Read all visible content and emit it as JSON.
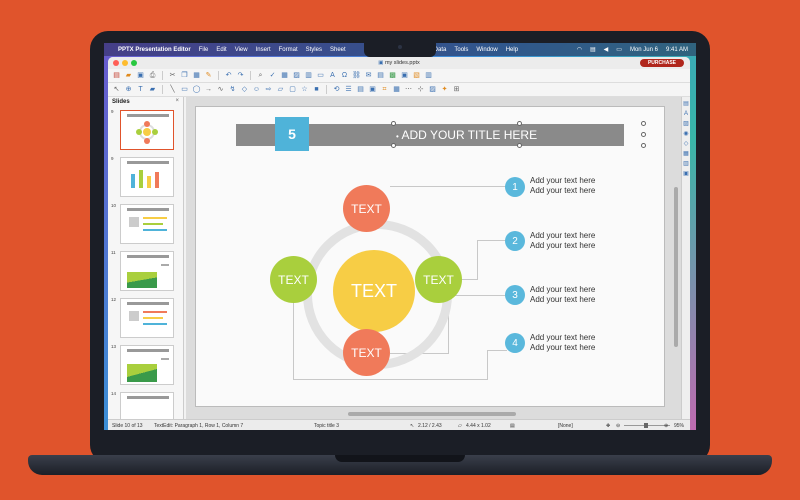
{
  "menubar": {
    "app_name": "PPTX Presentation Editor",
    "items": [
      "File",
      "Edit",
      "View",
      "Insert",
      "Format",
      "Styles",
      "Sheet",
      "Data",
      "Tools",
      "Window",
      "Help"
    ],
    "date": "Mon Jun 6",
    "time": "9:41 AM"
  },
  "window": {
    "title": "my slides.pptx",
    "purchase_label": "PURCHASE"
  },
  "slides_panel": {
    "title": "Slides",
    "close": "×",
    "thumbnails": [
      {
        "number": "9"
      },
      {
        "number": "9"
      },
      {
        "number": "10"
      },
      {
        "number": "11"
      },
      {
        "number": "12"
      },
      {
        "number": "13"
      },
      {
        "number": "14"
      }
    ]
  },
  "slide": {
    "number": "5",
    "title": "ADD YOUR TITLE HERE",
    "center_label": "TEXT",
    "top_label": "TEXT",
    "bottom_label": "TEXT",
    "left_label": "TEXT",
    "right_label": "TEXT",
    "items": [
      {
        "number": "1",
        "line1": "Add your text here",
        "line2": "Add your text here"
      },
      {
        "number": "2",
        "line1": "Add your text here",
        "line2": "Add your text here"
      },
      {
        "number": "3",
        "line1": "Add your text here",
        "line2": "Add your text here"
      },
      {
        "number": "4",
        "line1": "Add your text here",
        "line2": "Add your text here"
      }
    ]
  },
  "statusbar": {
    "slide_info": "Slide 10 of 13",
    "edit_info": "TextEdit: Paragraph 1, Row 1, Column 7",
    "topic": "Topic title 3",
    "position": "2.12 / 2.43",
    "size": "4.44 x 1.02",
    "selection": "[None]",
    "zoom": "95%"
  },
  "colors": {
    "background": "#e0542c",
    "accent_blue": "#5ab8dc",
    "coral": "#f07a5a",
    "lime": "#a9cf3d",
    "yellow": "#f7cd45",
    "purchase": "#b0261c"
  }
}
